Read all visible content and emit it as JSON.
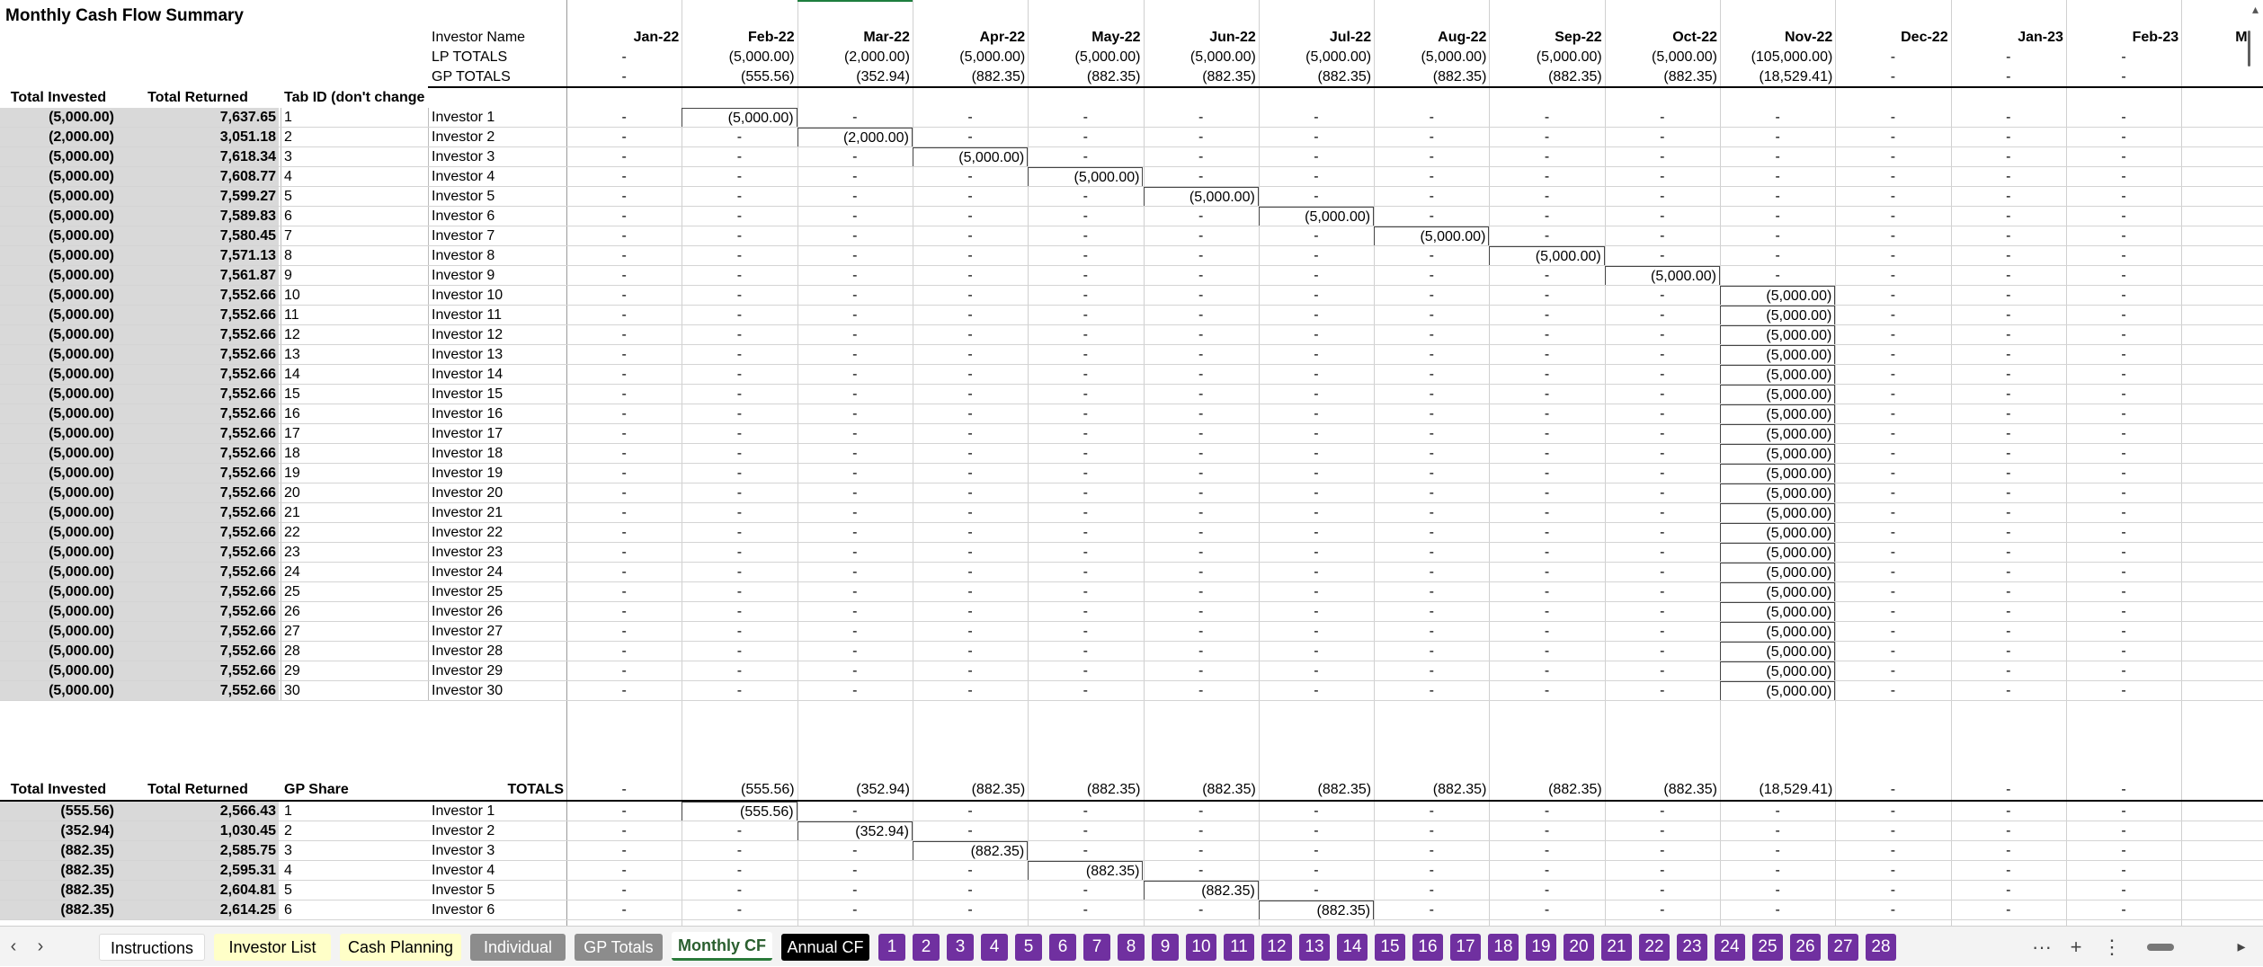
{
  "title": "Monthly Cash Flow Summary",
  "labels": {
    "investor_name": "Investor Name",
    "lp_totals": "LP TOTALS",
    "gp_totals": "GP TOTALS",
    "total_invested": "Total Invested",
    "total_returned": "Total Returned",
    "tab_id": "Tab ID (don't change)",
    "gp_share": "GP Share",
    "totals": "TOTALS"
  },
  "months": [
    "Jan-22",
    "Feb-22",
    "Mar-22",
    "Apr-22",
    "May-22",
    "Jun-22",
    "Jul-22",
    "Aug-22",
    "Sep-22",
    "Oct-22",
    "Nov-22",
    "Dec-22",
    "Jan-23",
    "Feb-23"
  ],
  "partial_next_month": "M",
  "lp_totals_values": [
    "-",
    "(5,000.00)",
    "(2,000.00)",
    "(5,000.00)",
    "(5,000.00)",
    "(5,000.00)",
    "(5,000.00)",
    "(5,000.00)",
    "(5,000.00)",
    "(5,000.00)",
    "(105,000.00)",
    "-",
    "-",
    "-"
  ],
  "gp_totals_values": [
    "-",
    "(555.56)",
    "(352.94)",
    "(882.35)",
    "(882.35)",
    "(882.35)",
    "(882.35)",
    "(882.35)",
    "(882.35)",
    "(882.35)",
    "(18,529.41)",
    "-",
    "-",
    "-"
  ],
  "lp_investors": [
    {
      "invested": "(5,000.00)",
      "returned": "7,637.65",
      "id": "1",
      "name": "Investor 1",
      "col": 1,
      "amt": "(5,000.00)"
    },
    {
      "invested": "(2,000.00)",
      "returned": "3,051.18",
      "id": "2",
      "name": "Investor 2",
      "col": 2,
      "amt": "(2,000.00)"
    },
    {
      "invested": "(5,000.00)",
      "returned": "7,618.34",
      "id": "3",
      "name": "Investor 3",
      "col": 3,
      "amt": "(5,000.00)"
    },
    {
      "invested": "(5,000.00)",
      "returned": "7,608.77",
      "id": "4",
      "name": "Investor 4",
      "col": 4,
      "amt": "(5,000.00)"
    },
    {
      "invested": "(5,000.00)",
      "returned": "7,599.27",
      "id": "5",
      "name": "Investor 5",
      "col": 5,
      "amt": "(5,000.00)"
    },
    {
      "invested": "(5,000.00)",
      "returned": "7,589.83",
      "id": "6",
      "name": "Investor 6",
      "col": 6,
      "amt": "(5,000.00)"
    },
    {
      "invested": "(5,000.00)",
      "returned": "7,580.45",
      "id": "7",
      "name": "Investor 7",
      "col": 7,
      "amt": "(5,000.00)"
    },
    {
      "invested": "(5,000.00)",
      "returned": "7,571.13",
      "id": "8",
      "name": "Investor 8",
      "col": 8,
      "amt": "(5,000.00)"
    },
    {
      "invested": "(5,000.00)",
      "returned": "7,561.87",
      "id": "9",
      "name": "Investor 9",
      "col": 9,
      "amt": "(5,000.00)"
    },
    {
      "invested": "(5,000.00)",
      "returned": "7,552.66",
      "id": "10",
      "name": "Investor 10",
      "col": 10,
      "amt": "(5,000.00)"
    },
    {
      "invested": "(5,000.00)",
      "returned": "7,552.66",
      "id": "11",
      "name": "Investor 11",
      "col": 10,
      "amt": "(5,000.00)"
    },
    {
      "invested": "(5,000.00)",
      "returned": "7,552.66",
      "id": "12",
      "name": "Investor 12",
      "col": 10,
      "amt": "(5,000.00)"
    },
    {
      "invested": "(5,000.00)",
      "returned": "7,552.66",
      "id": "13",
      "name": "Investor 13",
      "col": 10,
      "amt": "(5,000.00)"
    },
    {
      "invested": "(5,000.00)",
      "returned": "7,552.66",
      "id": "14",
      "name": "Investor 14",
      "col": 10,
      "amt": "(5,000.00)"
    },
    {
      "invested": "(5,000.00)",
      "returned": "7,552.66",
      "id": "15",
      "name": "Investor 15",
      "col": 10,
      "amt": "(5,000.00)"
    },
    {
      "invested": "(5,000.00)",
      "returned": "7,552.66",
      "id": "16",
      "name": "Investor 16",
      "col": 10,
      "amt": "(5,000.00)"
    },
    {
      "invested": "(5,000.00)",
      "returned": "7,552.66",
      "id": "17",
      "name": "Investor 17",
      "col": 10,
      "amt": "(5,000.00)"
    },
    {
      "invested": "(5,000.00)",
      "returned": "7,552.66",
      "id": "18",
      "name": "Investor 18",
      "col": 10,
      "amt": "(5,000.00)"
    },
    {
      "invested": "(5,000.00)",
      "returned": "7,552.66",
      "id": "19",
      "name": "Investor 19",
      "col": 10,
      "amt": "(5,000.00)"
    },
    {
      "invested": "(5,000.00)",
      "returned": "7,552.66",
      "id": "20",
      "name": "Investor 20",
      "col": 10,
      "amt": "(5,000.00)"
    },
    {
      "invested": "(5,000.00)",
      "returned": "7,552.66",
      "id": "21",
      "name": "Investor 21",
      "col": 10,
      "amt": "(5,000.00)"
    },
    {
      "invested": "(5,000.00)",
      "returned": "7,552.66",
      "id": "22",
      "name": "Investor 22",
      "col": 10,
      "amt": "(5,000.00)"
    },
    {
      "invested": "(5,000.00)",
      "returned": "7,552.66",
      "id": "23",
      "name": "Investor 23",
      "col": 10,
      "amt": "(5,000.00)"
    },
    {
      "invested": "(5,000.00)",
      "returned": "7,552.66",
      "id": "24",
      "name": "Investor 24",
      "col": 10,
      "amt": "(5,000.00)"
    },
    {
      "invested": "(5,000.00)",
      "returned": "7,552.66",
      "id": "25",
      "name": "Investor 25",
      "col": 10,
      "amt": "(5,000.00)"
    },
    {
      "invested": "(5,000.00)",
      "returned": "7,552.66",
      "id": "26",
      "name": "Investor 26",
      "col": 10,
      "amt": "(5,000.00)"
    },
    {
      "invested": "(5,000.00)",
      "returned": "7,552.66",
      "id": "27",
      "name": "Investor 27",
      "col": 10,
      "amt": "(5,000.00)"
    },
    {
      "invested": "(5,000.00)",
      "returned": "7,552.66",
      "id": "28",
      "name": "Investor 28",
      "col": 10,
      "amt": "(5,000.00)"
    },
    {
      "invested": "(5,000.00)",
      "returned": "7,552.66",
      "id": "29",
      "name": "Investor 29",
      "col": 10,
      "amt": "(5,000.00)"
    },
    {
      "invested": "(5,000.00)",
      "returned": "7,552.66",
      "id": "30",
      "name": "Investor 30",
      "col": 10,
      "amt": "(5,000.00)"
    }
  ],
  "gp_totals_row": [
    "-",
    "(555.56)",
    "(352.94)",
    "(882.35)",
    "(882.35)",
    "(882.35)",
    "(882.35)",
    "(882.35)",
    "(882.35)",
    "(882.35)",
    "(18,529.41)",
    "-",
    "-",
    "-"
  ],
  "gp_investors": [
    {
      "invested": "(555.56)",
      "returned": "2,566.43",
      "id": "1",
      "name": "Investor 1",
      "col": 1,
      "amt": "(555.56)"
    },
    {
      "invested": "(352.94)",
      "returned": "1,030.45",
      "id": "2",
      "name": "Investor 2",
      "col": 2,
      "amt": "(352.94)"
    },
    {
      "invested": "(882.35)",
      "returned": "2,585.75",
      "id": "3",
      "name": "Investor 3",
      "col": 3,
      "amt": "(882.35)"
    },
    {
      "invested": "(882.35)",
      "returned": "2,595.31",
      "id": "4",
      "name": "Investor 4",
      "col": 4,
      "amt": "(882.35)"
    },
    {
      "invested": "(882.35)",
      "returned": "2,604.81",
      "id": "5",
      "name": "Investor 5",
      "col": 5,
      "amt": "(882.35)"
    },
    {
      "invested": "(882.35)",
      "returned": "2,614.25",
      "id": "6",
      "name": "Investor 6",
      "col": 6,
      "amt": "(882.35)"
    }
  ],
  "tabs": [
    {
      "label": "Instructions",
      "style": "plain"
    },
    {
      "label": "Investor List",
      "style": "yellow"
    },
    {
      "label": "Cash Planning",
      "style": "yellow"
    },
    {
      "label": "Individual",
      "style": "grey"
    },
    {
      "label": "GP Totals",
      "style": "grey"
    },
    {
      "label": "Monthly CF",
      "style": "active"
    },
    {
      "label": "Annual CF",
      "style": "black"
    },
    {
      "label": "1",
      "style": "purple"
    },
    {
      "label": "2",
      "style": "purple"
    },
    {
      "label": "3",
      "style": "purple"
    },
    {
      "label": "4",
      "style": "purple"
    },
    {
      "label": "5",
      "style": "purple"
    },
    {
      "label": "6",
      "style": "purple"
    },
    {
      "label": "7",
      "style": "purple"
    },
    {
      "label": "8",
      "style": "purple"
    },
    {
      "label": "9",
      "style": "purple"
    },
    {
      "label": "10",
      "style": "purple"
    },
    {
      "label": "11",
      "style": "purple"
    },
    {
      "label": "12",
      "style": "purple"
    },
    {
      "label": "13",
      "style": "purple"
    },
    {
      "label": "14",
      "style": "purple"
    },
    {
      "label": "15",
      "style": "purple"
    },
    {
      "label": "16",
      "style": "purple"
    },
    {
      "label": "17",
      "style": "purple"
    },
    {
      "label": "18",
      "style": "purple"
    },
    {
      "label": "19",
      "style": "purple"
    },
    {
      "label": "20",
      "style": "purple"
    },
    {
      "label": "21",
      "style": "purple"
    },
    {
      "label": "22",
      "style": "purple"
    },
    {
      "label": "23",
      "style": "purple"
    },
    {
      "label": "24",
      "style": "purple"
    },
    {
      "label": "25",
      "style": "purple"
    },
    {
      "label": "26",
      "style": "purple"
    },
    {
      "label": "27",
      "style": "purple"
    },
    {
      "label": "28",
      "style": "purple"
    }
  ],
  "icons": {
    "prev": "chevron-left-icon",
    "next": "chevron-right-icon",
    "more": "more-tabs-icon",
    "add": "add-sheet-icon",
    "options": "sheet-options-icon",
    "scroll_right": "scroll-right-icon"
  },
  "tool_glyphs": {
    "more": "···",
    "add": "+",
    "options": "⋮",
    "prev": "‹",
    "next": "›",
    "scroll_right": "▸",
    "scroll_up": "▴"
  },
  "colors": {
    "purple_tab": "#7030a0",
    "yellow_tab": "#ffffc8",
    "grey_tab": "#8c8c8c",
    "active_tab_accent": "#2a7a3a",
    "grey_cell": "#d9d9d9"
  }
}
